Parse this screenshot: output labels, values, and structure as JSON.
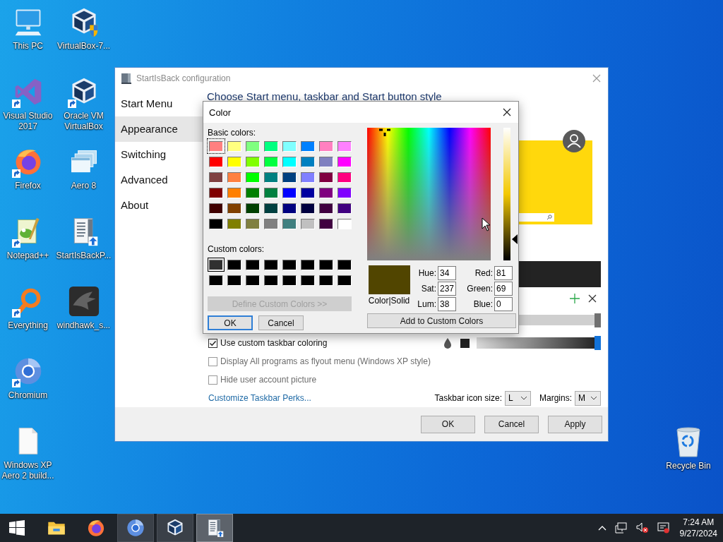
{
  "desktop": {
    "icons": [
      {
        "kind": "pc",
        "label": [
          "This PC"
        ],
        "shortcut": false
      },
      {
        "kind": "visual_studio",
        "label": [
          "Visual Studio",
          "2017"
        ],
        "shortcut": true
      },
      {
        "kind": "firefox",
        "label": [
          "Firefox"
        ],
        "shortcut": true
      },
      {
        "kind": "notepad",
        "label": [
          "Notepad++"
        ],
        "shortcut": true
      },
      {
        "kind": "everything",
        "label": [
          "Everything"
        ],
        "shortcut": true
      },
      {
        "kind": "chromium",
        "label": [
          "Chromium"
        ],
        "shortcut": true
      },
      {
        "kind": "file",
        "label": [
          "Windows XP",
          "Aero 2 build..."
        ],
        "shortcut": false
      },
      {
        "kind": "vbox_setup",
        "label": [
          "VirtualBox-7..."
        ],
        "shortcut": false
      },
      {
        "kind": "virtualbox",
        "label": [
          "Oracle VM",
          "VirtualBox"
        ],
        "shortcut": true
      },
      {
        "kind": "aero",
        "label": [
          "Aero 8"
        ],
        "shortcut": false
      },
      {
        "kind": "installer",
        "label": [
          "StartIsBackP..."
        ],
        "shortcut": false
      },
      {
        "kind": "windhawk",
        "label": [
          "windhawk_s..."
        ],
        "shortcut": false
      }
    ],
    "recycle_bin": {
      "label": "Recycle Bin"
    }
  },
  "config_window": {
    "title": "StartIsBack configuration",
    "sidebar": [
      {
        "label": "Start Menu",
        "selected": false
      },
      {
        "label": "Appearance",
        "selected": true
      },
      {
        "label": "Switching",
        "selected": false
      },
      {
        "label": "Advanced",
        "selected": false
      },
      {
        "label": "About",
        "selected": false
      }
    ],
    "heading": "Choose Start menu, taskbar and Start button style",
    "preview_slider": {
      "level": 1
    },
    "taskbar_coloring": {
      "label": "Use custom taskbar coloring",
      "checked": true,
      "level": 1
    },
    "options": [
      {
        "label": "Display All programs as flyout menu (Windows XP style)",
        "checked": false,
        "disabled": true
      },
      {
        "label": "Hide user account picture",
        "checked": false,
        "disabled": true
      }
    ],
    "link": "Customize Taskbar Perks...",
    "icon_size": {
      "label": "Taskbar icon size:",
      "value": "L"
    },
    "margins": {
      "label": "Margins:",
      "value": "M"
    },
    "buttons": [
      "OK",
      "Cancel",
      "Apply"
    ]
  },
  "color_dialog": {
    "title": "Color",
    "basic_label": "Basic colors:",
    "basic_colors": [
      {
        "color": "#ff8080",
        "selected": true
      },
      {
        "color": "#ffff80",
        "selected": false
      },
      {
        "color": "#80ff80",
        "selected": false
      },
      {
        "color": "#00ff80",
        "selected": false
      },
      {
        "color": "#80ffff",
        "selected": false
      },
      {
        "color": "#0080ff",
        "selected": false
      },
      {
        "color": "#ff80c0",
        "selected": false
      },
      {
        "color": "#ff80ff",
        "selected": false
      },
      {
        "color": "#ff0000",
        "selected": false
      },
      {
        "color": "#ffff00",
        "selected": false
      },
      {
        "color": "#80ff00",
        "selected": false
      },
      {
        "color": "#00ff40",
        "selected": false
      },
      {
        "color": "#00ffff",
        "selected": false
      },
      {
        "color": "#0080c0",
        "selected": false
      },
      {
        "color": "#8080c0",
        "selected": false
      },
      {
        "color": "#ff00ff",
        "selected": false
      },
      {
        "color": "#804040",
        "selected": false
      },
      {
        "color": "#ff8040",
        "selected": false
      },
      {
        "color": "#00ff00",
        "selected": false
      },
      {
        "color": "#008080",
        "selected": false
      },
      {
        "color": "#004080",
        "selected": false
      },
      {
        "color": "#8080ff",
        "selected": false
      },
      {
        "color": "#800040",
        "selected": false
      },
      {
        "color": "#ff0080",
        "selected": false
      },
      {
        "color": "#800000",
        "selected": false
      },
      {
        "color": "#ff8000",
        "selected": false
      },
      {
        "color": "#008000",
        "selected": false
      },
      {
        "color": "#008040",
        "selected": false
      },
      {
        "color": "#0000ff",
        "selected": false
      },
      {
        "color": "#0000a0",
        "selected": false
      },
      {
        "color": "#800080",
        "selected": false
      },
      {
        "color": "#8000ff",
        "selected": false
      },
      {
        "color": "#400000",
        "selected": false
      },
      {
        "color": "#804000",
        "selected": false
      },
      {
        "color": "#004000",
        "selected": false
      },
      {
        "color": "#004040",
        "selected": false
      },
      {
        "color": "#000080",
        "selected": false
      },
      {
        "color": "#000040",
        "selected": false
      },
      {
        "color": "#400040",
        "selected": false
      },
      {
        "color": "#400080",
        "selected": false
      },
      {
        "color": "#000000",
        "selected": false
      },
      {
        "color": "#808000",
        "selected": false
      },
      {
        "color": "#808040",
        "selected": false
      },
      {
        "color": "#808080",
        "selected": false
      },
      {
        "color": "#408080",
        "selected": false
      },
      {
        "color": "#c0c0c0",
        "selected": false
      },
      {
        "color": "#400040",
        "selected": false
      },
      {
        "color": "#ffffff",
        "selected": false
      }
    ],
    "custom_label": "Custom colors:",
    "custom_colors": [
      {
        "color": "#303030",
        "selected": true
      },
      {
        "color": "#000000",
        "selected": false
      },
      {
        "color": "#000000",
        "selected": false
      },
      {
        "color": "#000000",
        "selected": false
      },
      {
        "color": "#000000",
        "selected": false
      },
      {
        "color": "#000000",
        "selected": false
      },
      {
        "color": "#000000",
        "selected": false
      },
      {
        "color": "#000000",
        "selected": false
      },
      {
        "color": "#000000",
        "selected": false
      },
      {
        "color": "#000000",
        "selected": false
      },
      {
        "color": "#000000",
        "selected": false
      },
      {
        "color": "#000000",
        "selected": false
      },
      {
        "color": "#000000",
        "selected": false
      },
      {
        "color": "#000000",
        "selected": false
      },
      {
        "color": "#000000",
        "selected": false
      },
      {
        "color": "#000000",
        "selected": false
      }
    ],
    "define_button": {
      "label": "Define Custom Colors >>",
      "disabled": true
    },
    "ok": "OK",
    "cancel": "Cancel",
    "swatch": {
      "color": "#514500",
      "label": "Color|Solid"
    },
    "fields": [
      {
        "label": "Hue:",
        "value": "34"
      },
      {
        "label": "Red:",
        "value": "81"
      },
      {
        "label": "Sat:",
        "value": "237"
      },
      {
        "label": "Green:",
        "value": "69"
      },
      {
        "label": "Lum:",
        "value": "38"
      },
      {
        "label": "Blue:",
        "value": "0"
      }
    ],
    "add_button": "Add to Custom Colors"
  },
  "taskbar": {
    "apps": [
      {
        "kind": "explorer",
        "running": false,
        "selected": false
      },
      {
        "kind": "firefox",
        "running": false,
        "selected": false
      },
      {
        "kind": "chromium",
        "running": true,
        "selected": false
      },
      {
        "kind": "virtualbox",
        "running": true,
        "selected": false
      },
      {
        "kind": "installer",
        "running": true,
        "selected": true
      }
    ],
    "clock": {
      "time": "7:24 AM",
      "date": "9/27/2024"
    }
  }
}
